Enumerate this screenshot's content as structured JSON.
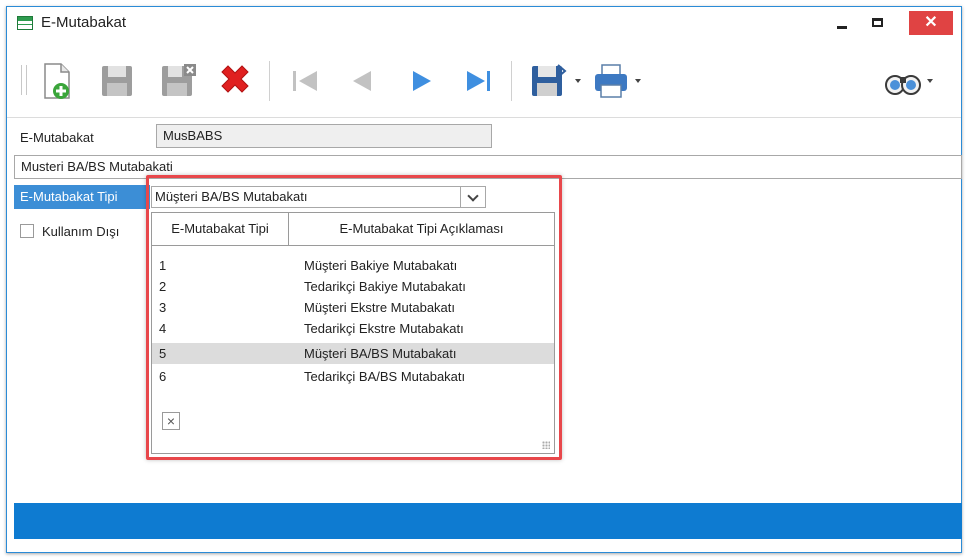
{
  "window": {
    "title": "E-Mutabakat",
    "close_symbol": "✕"
  },
  "form": {
    "code_label": "E-Mutabakat",
    "code_value": "MusBABS",
    "description_value": "Musteri BA/BS Mutabakati",
    "type_label": "E-Mutabakat Tipi",
    "type_value": "Müşteri BA/BS Mutabakatı",
    "inactive_label": "Kullanım Dışı"
  },
  "dropdown": {
    "headers": [
      "E-Mutabakat Tipi",
      "E-Mutabakat Tipi Açıklaması"
    ],
    "rows": [
      {
        "code": "1",
        "desc": "Müşteri Bakiye Mutabakatı"
      },
      {
        "code": "2",
        "desc": "Tedarikçi Bakiye Mutabakatı"
      },
      {
        "code": "3",
        "desc": "Müşteri Ekstre Mutabakatı"
      },
      {
        "code": "4",
        "desc": "Tedarikçi Ekstre Mutabakatı"
      },
      {
        "code": "5",
        "desc": "Müşteri BA/BS Mutabakatı"
      },
      {
        "code": "6",
        "desc": "Tedarikçi BA/BS Mutabakatı"
      }
    ],
    "selected_index": 4,
    "close_symbol": "×"
  },
  "toolbar_icons": [
    "new-document-icon",
    "save-icon",
    "save-delete-icon",
    "delete-icon",
    "first-record-icon",
    "previous-record-icon",
    "next-record-icon",
    "last-record-icon",
    "save-options-icon",
    "print-icon",
    "find-icon"
  ],
  "colors": {
    "accent": "#3c8ed6",
    "statusbar": "#0e7bd1",
    "highlight": "#e8474b",
    "close_button": "#e04343"
  }
}
